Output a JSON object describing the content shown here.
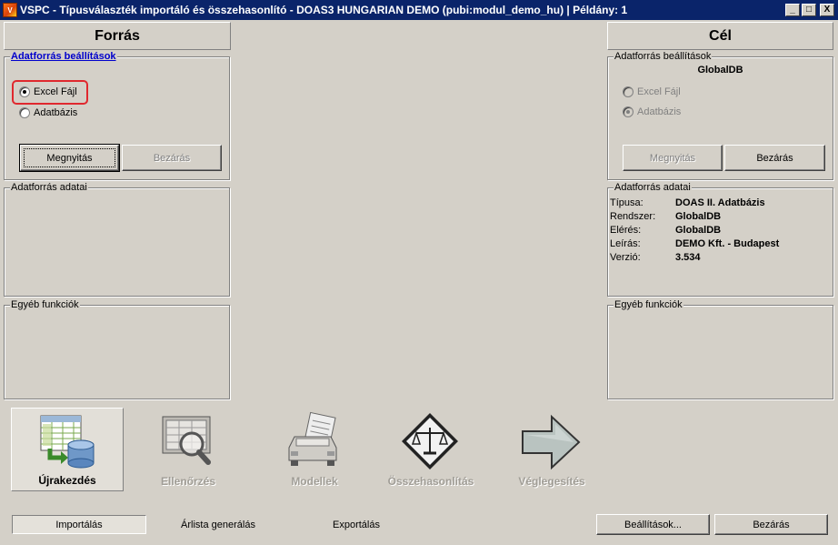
{
  "window": {
    "title": "VSPC - Típusválaszték importáló és összehasonlító - DOAS3 HUNGARIAN DEMO (pubi:modul_demo_hu) | Példány: 1",
    "minimize": "_",
    "maximize": "□",
    "close": "X"
  },
  "source": {
    "header": "Forrás",
    "settings_legend": "Adatforrás beállítások",
    "radio_excel": "Excel Fájl",
    "radio_db": "Adatbázis",
    "selected": "excel",
    "open_button": "Megnyitás",
    "close_button": "Bezárás",
    "data_legend": "Adatforrás adatai",
    "other_legend": "Egyéb funkciók"
  },
  "target": {
    "header": "Cél",
    "settings_legend": "Adatforrás beállítások",
    "db_name": "GlobalDB",
    "radio_excel": "Excel Fájl",
    "radio_db": "Adatbázis",
    "selected": "database",
    "open_button": "Megnyitás",
    "close_button": "Bezárás",
    "data_legend": "Adatforrás adatai",
    "info": [
      {
        "key": "Típusa:",
        "value": "DOAS II. Adatbázis"
      },
      {
        "key": "Rendszer:",
        "value": "GlobalDB"
      },
      {
        "key": "Elérés:",
        "value": "GlobalDB"
      },
      {
        "key": "Leírás:",
        "value": "DEMO Kft. - Budapest"
      },
      {
        "key": "Verzió:",
        "value": "3.534"
      }
    ],
    "other_legend": "Egyéb funkciók"
  },
  "toolbar": {
    "items": [
      {
        "label": "Újrakezdés",
        "icon": "restart-icon",
        "active": true
      },
      {
        "label": "Ellenőrzés",
        "icon": "inspect-icon",
        "active": false
      },
      {
        "label": "Modellek",
        "icon": "models-icon",
        "active": false
      },
      {
        "label": "Összehasonlítás",
        "icon": "compare-icon",
        "active": false
      },
      {
        "label": "Véglegesítés",
        "icon": "finalize-icon",
        "active": false
      }
    ]
  },
  "bottom": {
    "tabs": [
      "Importálás",
      "Árlista generálás",
      "Exportálás"
    ],
    "active_tab": "Importálás",
    "settings_button": "Beállítások...",
    "close_button": "Bezárás"
  },
  "colors": {
    "titlebar": "#0a246a",
    "face": "#d4d0c8",
    "highlight_ring": "#e0282e",
    "link": "#0000cc"
  }
}
